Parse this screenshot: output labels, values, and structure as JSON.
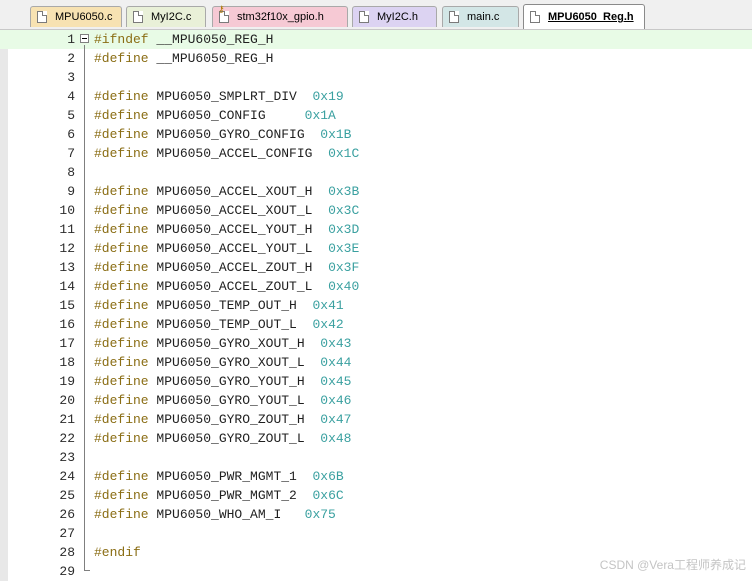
{
  "tabs": [
    {
      "label": "MPU6050.c",
      "color": "#f7e2b2",
      "icon": "c-file-icon",
      "active": false
    },
    {
      "label": "MyI2C.c",
      "color": "#e9f0d8",
      "icon": "c-file-icon",
      "active": false
    },
    {
      "label": "stm32f10x_gpio.h",
      "color": "#f6c9d4",
      "icon": "locked-h-file-icon",
      "active": false
    },
    {
      "label": "MyI2C.h",
      "color": "#dcd3f2",
      "icon": "h-file-icon",
      "active": false
    },
    {
      "label": "main.c",
      "color": "#d3e6e6",
      "icon": "c-file-icon",
      "active": false
    },
    {
      "label": "MPU6050_Reg.h",
      "color": "#ffffff",
      "icon": "h-file-icon",
      "active": true
    }
  ],
  "editor": {
    "current_line": 1,
    "lines": [
      {
        "n": "1",
        "kw": "#ifndef",
        "name": "__MPU6050_REG_H",
        "val": ""
      },
      {
        "n": "2",
        "kw": "#define",
        "name": "__MPU6050_REG_H",
        "val": ""
      },
      {
        "n": "3",
        "kw": "",
        "name": "",
        "val": ""
      },
      {
        "n": "4",
        "kw": "#define",
        "name": "MPU6050_SMPLRT_DIV",
        "val": "0x19"
      },
      {
        "n": "5",
        "kw": "#define",
        "name": "MPU6050_CONFIG",
        "val": "0x1A"
      },
      {
        "n": "6",
        "kw": "#define",
        "name": "MPU6050_GYRO_CONFIG",
        "val": "0x1B"
      },
      {
        "n": "7",
        "kw": "#define",
        "name": "MPU6050_ACCEL_CONFIG",
        "val": "0x1C"
      },
      {
        "n": "8",
        "kw": "",
        "name": "",
        "val": ""
      },
      {
        "n": "9",
        "kw": "#define",
        "name": "MPU6050_ACCEL_XOUT_H",
        "val": "0x3B"
      },
      {
        "n": "10",
        "kw": "#define",
        "name": "MPU6050_ACCEL_XOUT_L",
        "val": "0x3C"
      },
      {
        "n": "11",
        "kw": "#define",
        "name": "MPU6050_ACCEL_YOUT_H",
        "val": "0x3D"
      },
      {
        "n": "12",
        "kw": "#define",
        "name": "MPU6050_ACCEL_YOUT_L",
        "val": "0x3E"
      },
      {
        "n": "13",
        "kw": "#define",
        "name": "MPU6050_ACCEL_ZOUT_H",
        "val": "0x3F"
      },
      {
        "n": "14",
        "kw": "#define",
        "name": "MPU6050_ACCEL_ZOUT_L",
        "val": "0x40"
      },
      {
        "n": "15",
        "kw": "#define",
        "name": "MPU6050_TEMP_OUT_H",
        "val": "0x41"
      },
      {
        "n": "16",
        "kw": "#define",
        "name": "MPU6050_TEMP_OUT_L",
        "val": "0x42"
      },
      {
        "n": "17",
        "kw": "#define",
        "name": "MPU6050_GYRO_XOUT_H",
        "val": "0x43"
      },
      {
        "n": "18",
        "kw": "#define",
        "name": "MPU6050_GYRO_XOUT_L",
        "val": "0x44"
      },
      {
        "n": "19",
        "kw": "#define",
        "name": "MPU6050_GYRO_YOUT_H",
        "val": "0x45"
      },
      {
        "n": "20",
        "kw": "#define",
        "name": "MPU6050_GYRO_YOUT_L",
        "val": "0x46"
      },
      {
        "n": "21",
        "kw": "#define",
        "name": "MPU6050_GYRO_ZOUT_H",
        "val": "0x47"
      },
      {
        "n": "22",
        "kw": "#define",
        "name": "MPU6050_GYRO_ZOUT_L",
        "val": "0x48"
      },
      {
        "n": "23",
        "kw": "",
        "name": "",
        "val": ""
      },
      {
        "n": "24",
        "kw": "#define",
        "name": "MPU6050_PWR_MGMT_1",
        "val": "0x6B"
      },
      {
        "n": "25",
        "kw": "#define",
        "name": "MPU6050_PWR_MGMT_2",
        "val": "0x6C"
      },
      {
        "n": "26",
        "kw": "#define",
        "name": "MPU6050_WHO_AM_I",
        "val": "0x75"
      },
      {
        "n": "27",
        "kw": "",
        "name": "",
        "val": ""
      },
      {
        "n": "28",
        "kw": "#endif",
        "name": "",
        "val": ""
      },
      {
        "n": "29",
        "kw": "",
        "name": "",
        "val": ""
      }
    ]
  },
  "watermark": "CSDN @Vera工程师养成记"
}
